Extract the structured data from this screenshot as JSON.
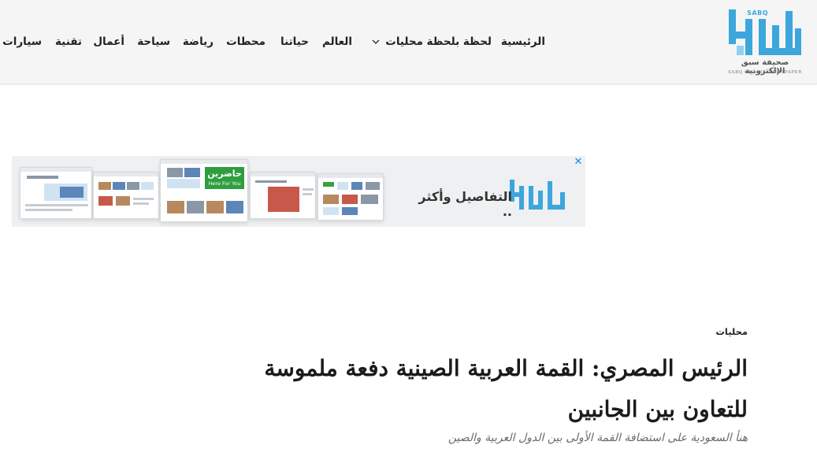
{
  "header": {
    "logo": {
      "tag": "SABQ",
      "arabic_name": "صحيفة سبق الإلكترونية",
      "english_name": "SABQ ONLINE NEWSPAPER",
      "icon": "sabq-logo-icon",
      "brand_color": "#3da6dd"
    },
    "nav": [
      {
        "label": "الرئيسية"
      },
      {
        "label": "لحظة بلحظة"
      },
      {
        "label": "محليات",
        "has_dropdown": true
      },
      {
        "label": "العالم"
      },
      {
        "label": "حياتنا"
      },
      {
        "label": "محطات"
      },
      {
        "label": "رياضة"
      },
      {
        "label": "سياحة"
      },
      {
        "label": "أعمال"
      },
      {
        "label": "تقنية"
      },
      {
        "label": "سيارات"
      }
    ]
  },
  "ad": {
    "text": "التفاصيل وأكثر ..",
    "close_icon": "close-icon",
    "badge": {
      "title": "حاضرين",
      "subtitle": "Here For You"
    },
    "accent": "#1e88e5"
  },
  "article": {
    "category": "محليات",
    "title_line1": "الرئيس المصري: القمة العربية الصينية دفعة ملموسة",
    "title_line2": "للتعاون بين الجانبين",
    "subtitle": "هنأ السعودية على استضافة القمة الأولى بين الدول العربية والصين"
  }
}
